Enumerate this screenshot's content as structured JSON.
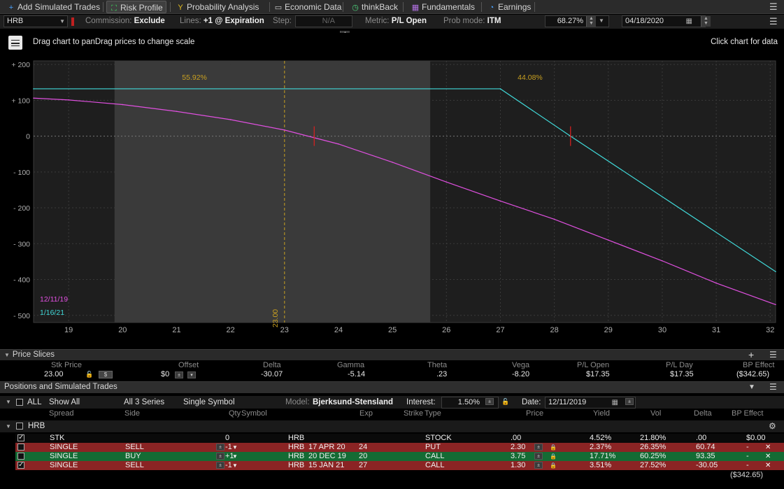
{
  "tabs": [
    {
      "label": "Add Simulated Trades",
      "icon": "plus-icon"
    },
    {
      "label": "Risk Profile",
      "icon": "risk-profile-icon",
      "active": true
    },
    {
      "label": "Probability Analysis",
      "icon": "probability-icon"
    },
    {
      "label": "Economic Data",
      "icon": "economic-data-icon"
    },
    {
      "label": "thinkBack",
      "icon": "clock-icon"
    },
    {
      "label": "Fundamentals",
      "icon": "fundamentals-icon"
    },
    {
      "label": "Earnings",
      "icon": "earnings-icon"
    }
  ],
  "controls": {
    "symbol": "HRB",
    "commission_label": "Commission:",
    "commission_value": "Exclude",
    "lines_label": "Lines:",
    "lines_value": "+1 @ Expiration",
    "step_label": "Step:",
    "step_value": "N/A",
    "metric_label": "Metric:",
    "metric_value": "P/L Open",
    "prob_label": "Prob mode:",
    "prob_value": "ITM",
    "prob_pct": "68.27%",
    "date": "04/18/2020"
  },
  "chart_header": {
    "hint_left": "Drag chart to panDrag prices to change scale",
    "hint_right": "Click chart for data"
  },
  "chart_data": {
    "type": "line",
    "x_ticks": [
      "19",
      "20",
      "21",
      "22",
      "23",
      "24",
      "25",
      "26",
      "27",
      "28",
      "29",
      "30",
      "31",
      "32"
    ],
    "y_ticks": [
      "+ 200",
      "+ 100",
      "0",
      "- 100",
      "- 200",
      "- 300",
      "- 400",
      "- 500"
    ],
    "xlim": [
      18.35,
      32.1
    ],
    "ylim": [
      -520,
      210
    ],
    "current_price": 23.0,
    "current_price_label": "23.00",
    "prob_left": "55.92%",
    "prob_right": "44.08%",
    "prob_band": [
      19.85,
      25.7
    ],
    "series": [
      {
        "name": "12/11/19",
        "color": "#e050e0",
        "x": [
          18.35,
          19,
          20,
          21,
          22,
          23,
          24,
          25,
          26,
          27,
          28,
          29,
          30,
          31,
          32.1
        ],
        "y": [
          106,
          101,
          88,
          69,
          46,
          17,
          -22,
          -73,
          -128,
          -181,
          -232,
          -290,
          -348,
          -410,
          -470
        ]
      },
      {
        "name": "1/16/21",
        "color": "#40d8d8",
        "x": [
          18.35,
          27,
          28.3,
          32.1
        ],
        "y": [
          132,
          132,
          0,
          -378
        ]
      }
    ],
    "breakevens": [
      23.55,
      28.3
    ]
  },
  "price_slices": {
    "title": "Price Slices",
    "headers": [
      "Stk Price",
      "Offset",
      "Delta",
      "Gamma",
      "Theta",
      "Vega",
      "P/L Open",
      "P/L Day",
      "BP Effect"
    ],
    "stk_price": "23.00",
    "dollar": "$",
    "offset": "$0",
    "delta": "-30.07",
    "gamma": "-5.14",
    "theta": ".23",
    "vega": "-8.20",
    "pl_open": "$17.35",
    "pl_day": "$17.35",
    "bp_effect": "($342.65)"
  },
  "positions": {
    "title": "Positions and Simulated Trades",
    "all_label": "ALL",
    "show_all": "Show All",
    "series_filter": "All 3 Series",
    "symbol_filter": "Single Symbol",
    "model_label": "Model:",
    "model_value": "Bjerksund-Stensland",
    "interest_label": "Interest:",
    "interest_value": "1.50%",
    "date_label": "Date:",
    "date_value": "12/11/2019",
    "headers": [
      "Spread",
      "Side",
      "Qty",
      "Symbol",
      "Exp",
      "Strike",
      "Type",
      "Price",
      "Yield",
      "Vol",
      "Delta",
      "BP Effect"
    ],
    "group": "HRB",
    "rows": [
      {
        "spread": "STK",
        "side": "",
        "qty": "0",
        "symbol": "HRB",
        "exp": "",
        "strike": "",
        "type": "STOCK",
        "price": ".00",
        "yield": "4.52%",
        "vol": "21.80%",
        "delta": ".00",
        "bp": "$0.00",
        "style": "stk",
        "checked": true
      },
      {
        "spread": "SINGLE",
        "side": "SELL",
        "qty": "-1",
        "symbol": "HRB",
        "exp": "17 APR 20",
        "strike": "24",
        "type": "PUT",
        "price": "2.30",
        "yield": "2.37%",
        "vol": "26.35%",
        "delta": "60.74",
        "bp": "-",
        "style": "red",
        "checked": false
      },
      {
        "spread": "SINGLE",
        "side": "BUY",
        "qty": "+1",
        "symbol": "HRB",
        "exp": "20 DEC 19",
        "strike": "20",
        "type": "CALL",
        "price": "3.75",
        "yield": "17.71%",
        "vol": "60.25%",
        "delta": "93.35",
        "bp": "-",
        "style": "green",
        "checked": false
      },
      {
        "spread": "SINGLE",
        "side": "SELL",
        "qty": "-1",
        "symbol": "HRB",
        "exp": "15 JAN 21",
        "strike": "27",
        "type": "CALL",
        "price": "1.30",
        "yield": "3.51%",
        "vol": "27.52%",
        "delta": "-30.05",
        "bp": "-",
        "style": "red",
        "checked": true
      }
    ],
    "total_bp": "($342.65)"
  }
}
